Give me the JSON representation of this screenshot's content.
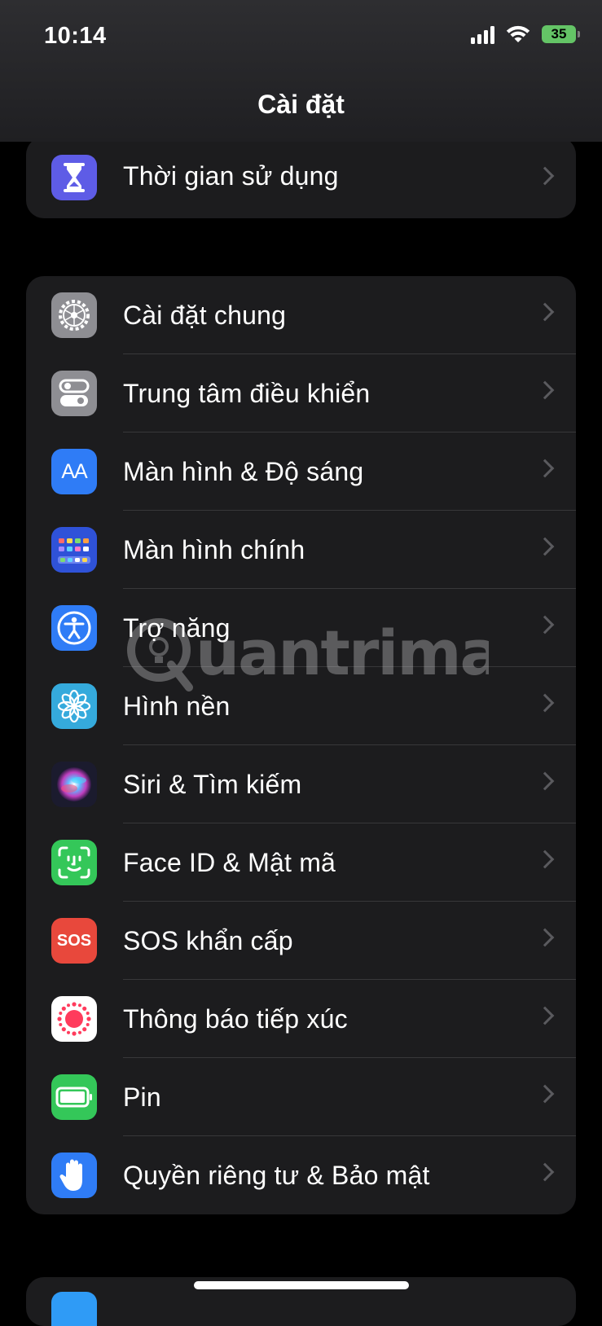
{
  "status_bar": {
    "time": "10:14",
    "battery": "35"
  },
  "nav": {
    "title": "Cài đặt"
  },
  "group_top": [
    {
      "label": "Thời gian sử dụng",
      "icon": "hourglass-icon",
      "color": "#5e5ce6"
    }
  ],
  "group_main": [
    {
      "label": "Cài đặt chung",
      "icon": "gear-icon",
      "color": "#8e8e93"
    },
    {
      "label": "Trung tâm điều khiển",
      "icon": "toggle-switches-icon",
      "color": "#8e8e93"
    },
    {
      "label": "Màn hình & Độ sáng",
      "icon": "text-size-icon",
      "icon_text": "AA",
      "color": "#2f7cf6"
    },
    {
      "label": "Màn hình chính",
      "icon": "home-grid-icon",
      "color": "#2f52d8"
    },
    {
      "label": "Trợ năng",
      "icon": "accessibility-icon",
      "color": "#2f7cf6"
    },
    {
      "label": "Hình nền",
      "icon": "flower-icon",
      "color": "#35aadc"
    },
    {
      "label": "Siri & Tìm kiếm",
      "icon": "siri-icon",
      "color": "#1b1b2e"
    },
    {
      "label": "Face ID & Mật mã",
      "icon": "face-id-icon",
      "color": "#34c759"
    },
    {
      "label": "SOS khẩn cấp",
      "icon": "sos-icon",
      "icon_text": "SOS",
      "color": "#e8483c"
    },
    {
      "label": "Thông báo tiếp xúc",
      "icon": "exposure-dots-icon",
      "color": "#ffffff"
    },
    {
      "label": "Pin",
      "icon": "battery-icon",
      "color": "#34c759"
    },
    {
      "label": "Quyền riêng tư & Bảo mật",
      "icon": "hand-icon",
      "color": "#2f7cf6"
    }
  ]
}
